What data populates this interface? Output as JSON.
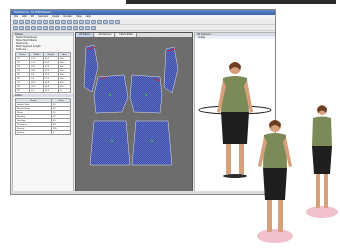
{
  "app": {
    "title": "TechGems - CLO3D/Viewer",
    "menu": [
      "File",
      "Edit",
      "3D",
      "Garment",
      "Avatar",
      "Render",
      "View",
      "Help"
    ]
  },
  "left_panel": {
    "title": "Pattern",
    "options": [
      "Select Points/Lines",
      "Show Notch Marks",
      "Seam Line",
      "Mark Segment Length",
      "Fold Line"
    ],
    "table_headers": [
      "Name",
      "Width",
      "Height",
      "Area"
    ],
    "table_rows": [
      [
        "P1",
        "12.4",
        "30.2",
        "280"
      ],
      [
        "P2",
        "12.4",
        "30.2",
        "280"
      ],
      [
        "P3",
        "18.1",
        "52.6",
        "640"
      ],
      [
        "P4",
        "18.1",
        "52.6",
        "640"
      ],
      [
        "P5",
        "9.5",
        "22.0",
        "150"
      ],
      [
        "P6",
        "9.5",
        "22.0",
        "150"
      ],
      [
        "P7",
        "20.3",
        "44.8",
        "620"
      ],
      [
        "P8",
        "20.3",
        "44.8",
        "620"
      ],
      [
        "P9",
        "6.0",
        "14.2",
        "72"
      ]
    ],
    "fabric_title": "Fabric",
    "fabric_headers": [
      "Name",
      "Value"
    ],
    "fabric_rows": [
      [
        "Stretch-Weft",
        "30"
      ],
      [
        "Stretch-Warp",
        "30"
      ],
      [
        "Shear",
        "20"
      ],
      [
        "Bending",
        "15"
      ],
      [
        "Buckling",
        "40"
      ],
      [
        "Thickness",
        "0.8"
      ],
      [
        "Density",
        "220"
      ],
      [
        "Friction",
        "3"
      ]
    ]
  },
  "center_panel": {
    "tabs": [
      "2D Pattern",
      "3D Garment",
      "Fabric Editor"
    ]
  },
  "right_panel": {
    "title": "3D Garment",
    "toolbar_label": "Avatar"
  },
  "colors": {
    "canvas": "#6d6d6d",
    "pattern_fill": "#3d4ea8",
    "seam": "#e02020",
    "avatar_shadow": "#f0c0cc",
    "shirt": "#7c8a58",
    "skirt": "#1f1f1f"
  }
}
